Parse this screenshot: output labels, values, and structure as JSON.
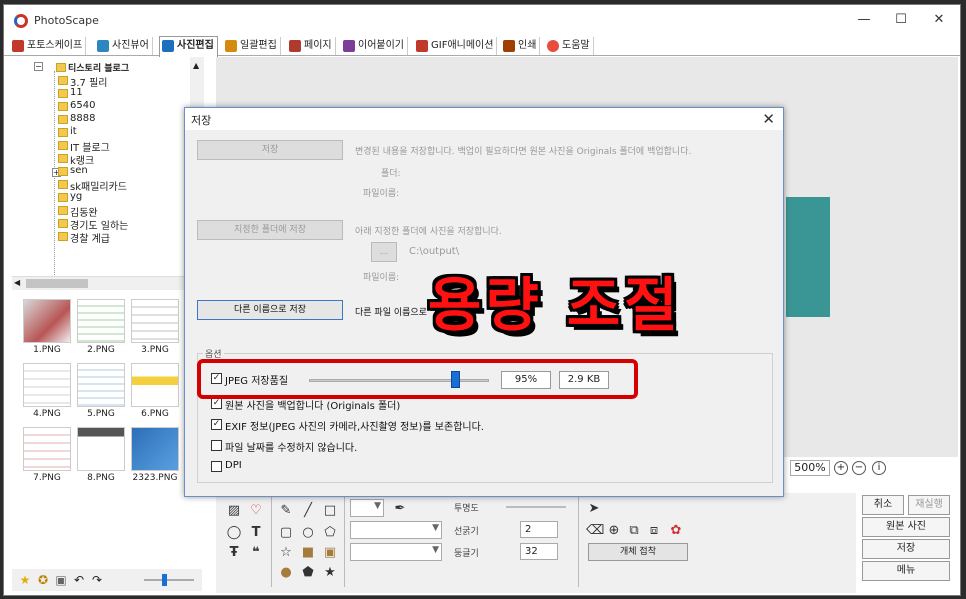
{
  "app": {
    "title": "PhotoScape"
  },
  "tabs": [
    {
      "label": "포토스케이프",
      "color": "#c0392b"
    },
    {
      "label": "사진뷰어",
      "color": "#2e86c1"
    },
    {
      "label": "사진편집",
      "color": "#1f6fbf"
    },
    {
      "label": "일괄편집",
      "color": "#d68910"
    },
    {
      "label": "페이지",
      "color": "#b03a2e"
    },
    {
      "label": "이어붙이기",
      "color": "#7d3c98"
    },
    {
      "label": "GIF애니메이션",
      "color": "#c0392b"
    },
    {
      "label": "인쇄",
      "color": "#a04000"
    },
    {
      "label": "도움말",
      "color": "#e74c3c"
    }
  ],
  "tree": {
    "root": "티스토리 블로그",
    "items": [
      "3.7 필리",
      "11",
      "6540",
      "8888",
      "it",
      "IT 블로그",
      "k랭크",
      "sen",
      "sk패밀리카드",
      "yg",
      "김동완",
      "경기도 일하는",
      "경찰 계급"
    ]
  },
  "thumbs": [
    "1.PNG",
    "2.PNG",
    "3.PNG",
    "4.PNG",
    "5.PNG",
    "6.PNG",
    "7.PNG",
    "8.PNG",
    "2323.PNG"
  ],
  "zoom": {
    "value": "500%"
  },
  "tools": {
    "transparency_label": "투명도",
    "line_width_label": "선굵기",
    "roundness_label": "둥글기",
    "line_width_value": "2",
    "roundness_value": "32",
    "attach_object_label": "개체 접착"
  },
  "right_buttons": {
    "cancel": "취소",
    "redo": "재실행",
    "original": "원본 사진",
    "save": "저장",
    "menu": "메뉴"
  },
  "dialog": {
    "title": "저장",
    "save_button": "저장",
    "save_desc": "변경된 내용을 저장합니다. 백업이 필요하다면 원본 사진을 Originals 폴더에 백업합니다.",
    "folder_label": "폴더:",
    "filename_label": "파일이름:",
    "save_to_folder_button": "지정한 폴더에 저장",
    "save_to_folder_desc": "아래 지정한 폴더에 사진을 저장합니다.",
    "browse_button": "...",
    "output_path": "C:\\output\\",
    "filename_label2": "파일이름:",
    "save_as_button": "다른 이름으로 저장",
    "save_as_desc": "다른 파일 이름으로",
    "options_label": "옵션",
    "jpeg_quality_label": "JPEG 저장품질",
    "quality_value": "95%",
    "quality_fraction": 0.85,
    "size_value": "2.9 KB",
    "backup_label": "원본 사진을 백업합니다 (Originals 폴더)",
    "exif_label": "EXIF 정보(JPEG 사진의 카메라,사진촬영 정보)를 보존합니다.",
    "date_label": "파일 날짜를 수정하지 않습니다.",
    "dpi_label": "DPI"
  },
  "overlay": {
    "text": "용량 조절",
    "color": "#ff1111"
  }
}
